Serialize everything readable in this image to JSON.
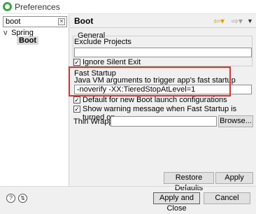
{
  "window": {
    "title": "Preferences"
  },
  "sidebar": {
    "filter_value": "boot",
    "tree": [
      {
        "label": "Spring",
        "expanded": true
      },
      {
        "label": "Boot",
        "selected": true
      }
    ]
  },
  "page": {
    "title": "Boot",
    "general": {
      "legend": "General",
      "exclude_projects_label": "Exclude Projects",
      "exclude_projects_value": ""
    },
    "ignore_silent_exit": {
      "label": "Ignore Silent Exit",
      "checked": true
    },
    "fast_startup": {
      "legend": "Fast Startup",
      "description": "Java VM arguments to trigger app's fast startup",
      "value": "-noverify -XX:TieredStopAtLevel=1"
    },
    "default_new_launch": {
      "label": "Default for new Boot launch configurations",
      "checked": true
    },
    "show_warning": {
      "label": "Show warning message when Fast Startup is turned on",
      "checked": true
    },
    "thin_wrapper": {
      "label": "Thin Wrapper",
      "value": "",
      "browse_label": "Browse..."
    },
    "restore_defaults_label": "Restore Defaults",
    "apply_label": "Apply"
  },
  "footer": {
    "apply_close_label": "Apply and Close",
    "cancel_label": "Cancel"
  },
  "icons": {
    "app": "eclipse-icon",
    "back": "arrow-left-icon",
    "forward": "arrow-right-icon",
    "menu": "chevron-down-icon",
    "help": "help-icon",
    "import": "import-export-icon"
  },
  "colors": {
    "highlight": "#e03030",
    "primary_border": "#0078d7"
  }
}
